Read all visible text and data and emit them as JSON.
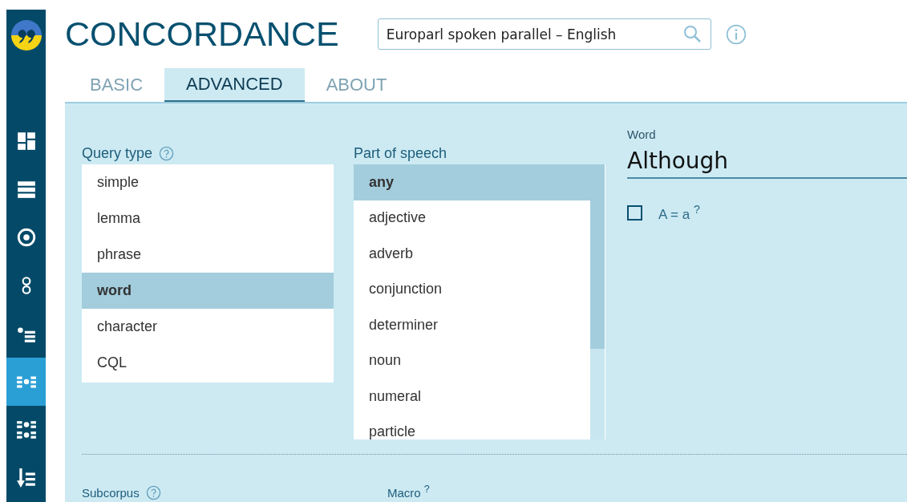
{
  "app": {
    "title": "CONCORDANCE"
  },
  "corpus": {
    "value": "Europarl spoken parallel – English"
  },
  "sidebar": {
    "items": [
      {
        "selected": false
      },
      {
        "selected": false
      },
      {
        "selected": false
      },
      {
        "selected": false
      },
      {
        "selected": false
      },
      {
        "selected": true
      },
      {
        "selected": false
      },
      {
        "selected": false
      }
    ]
  },
  "tabs": [
    {
      "label": "BASIC",
      "selected": false
    },
    {
      "label": "ADVANCED",
      "selected": true
    },
    {
      "label": "ABOUT",
      "selected": false
    }
  ],
  "query_type": {
    "label": "Query type",
    "items": [
      {
        "label": "simple",
        "selected": false
      },
      {
        "label": "lemma",
        "selected": false
      },
      {
        "label": "phrase",
        "selected": false
      },
      {
        "label": "word",
        "selected": true
      },
      {
        "label": "character",
        "selected": false
      },
      {
        "label": "CQL",
        "selected": false
      }
    ]
  },
  "part_of_speech": {
    "label": "Part of speech",
    "items": [
      {
        "label": "any",
        "selected": true
      },
      {
        "label": "adjective",
        "selected": false
      },
      {
        "label": "adverb",
        "selected": false
      },
      {
        "label": "conjunction",
        "selected": false
      },
      {
        "label": "determiner",
        "selected": false
      },
      {
        "label": "noun",
        "selected": false
      },
      {
        "label": "numeral",
        "selected": false
      },
      {
        "label": "particle",
        "selected": false
      }
    ]
  },
  "word": {
    "label": "Word",
    "value": "Although"
  },
  "case_option": {
    "label": "A = a $^{?}$",
    "checked": false
  },
  "subcorpus": {
    "label": "Subcorpus"
  },
  "macro": {
    "label": "Macro $^{?}$"
  }
}
